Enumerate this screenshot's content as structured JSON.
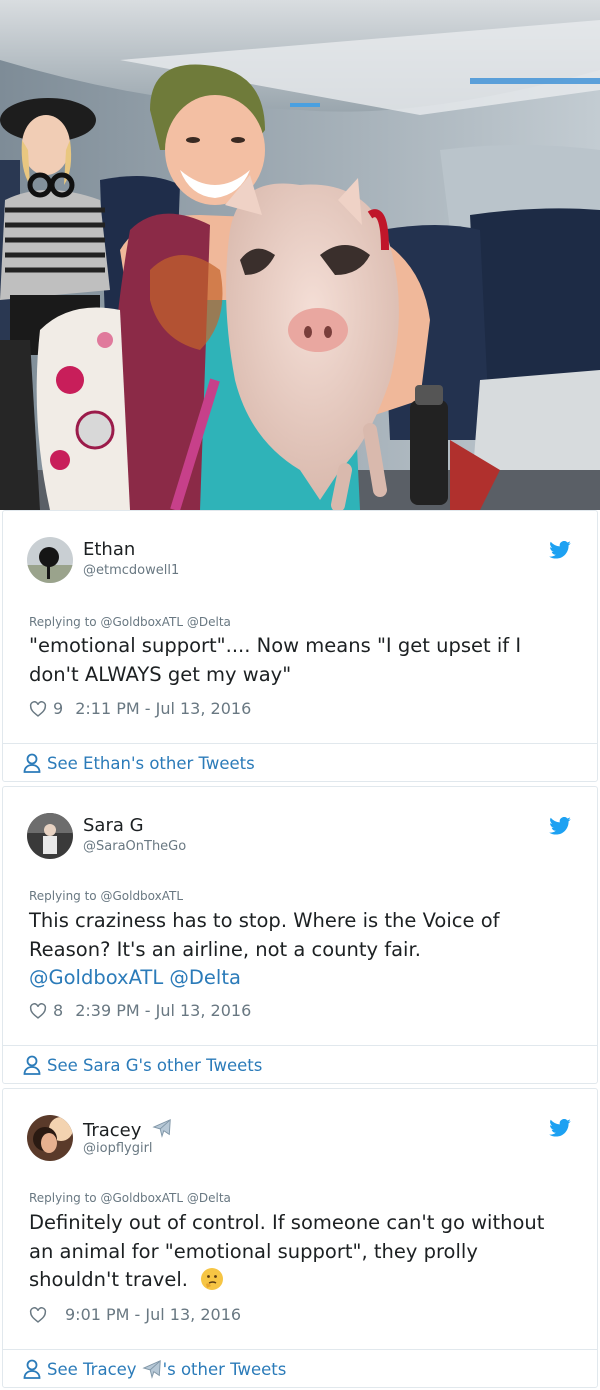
{
  "photo": {
    "description_icon": "airplane-cabin-woman-holding-pig-photo"
  },
  "tweets": [
    {
      "name": "Ethan",
      "handle": "@etmcdowell1",
      "reply_to": "Replying to @GoldboxATL @Delta",
      "text_line1": "\"emotional support\".... Now means \"I get upset if I",
      "text_line2": "don't ALWAYS get my way\"",
      "likes": "9",
      "timestamp": "2:11 PM - Jul 13, 2016",
      "other_tweets": "See Ethan's other Tweets"
    },
    {
      "name": "Sara G",
      "handle": "@SaraOnTheGo",
      "reply_to": "Replying to @GoldboxATL",
      "text_line1": "This craziness has to stop. Where is the Voice of",
      "text_line2": "Reason? It's an airline, not a county fair.",
      "mention1": "@GoldboxATL",
      "mention2": "@Delta",
      "likes": "8",
      "timestamp": "2:39 PM - Jul 13, 2016",
      "other_tweets": "See Sara G's other Tweets"
    },
    {
      "name": "Tracey",
      "handle": "@iopflygirl",
      "reply_to": "Replying to @GoldboxATL @Delta",
      "text_line1": "Definitely out of control. If someone can't go without",
      "text_line2": "an animal for \"emotional support\", they prolly",
      "text_line3": "shouldn't travel.",
      "likes": "",
      "timestamp": "9:01 PM - Jul 13, 2016",
      "other_prefix": "See Tracey",
      "other_suffix": "'s other Tweets"
    }
  ],
  "colors": {
    "link": "#2b7bb9",
    "muted": "#697882",
    "border": "#e1e8ed",
    "twitter_blue": "#1da1f2"
  }
}
